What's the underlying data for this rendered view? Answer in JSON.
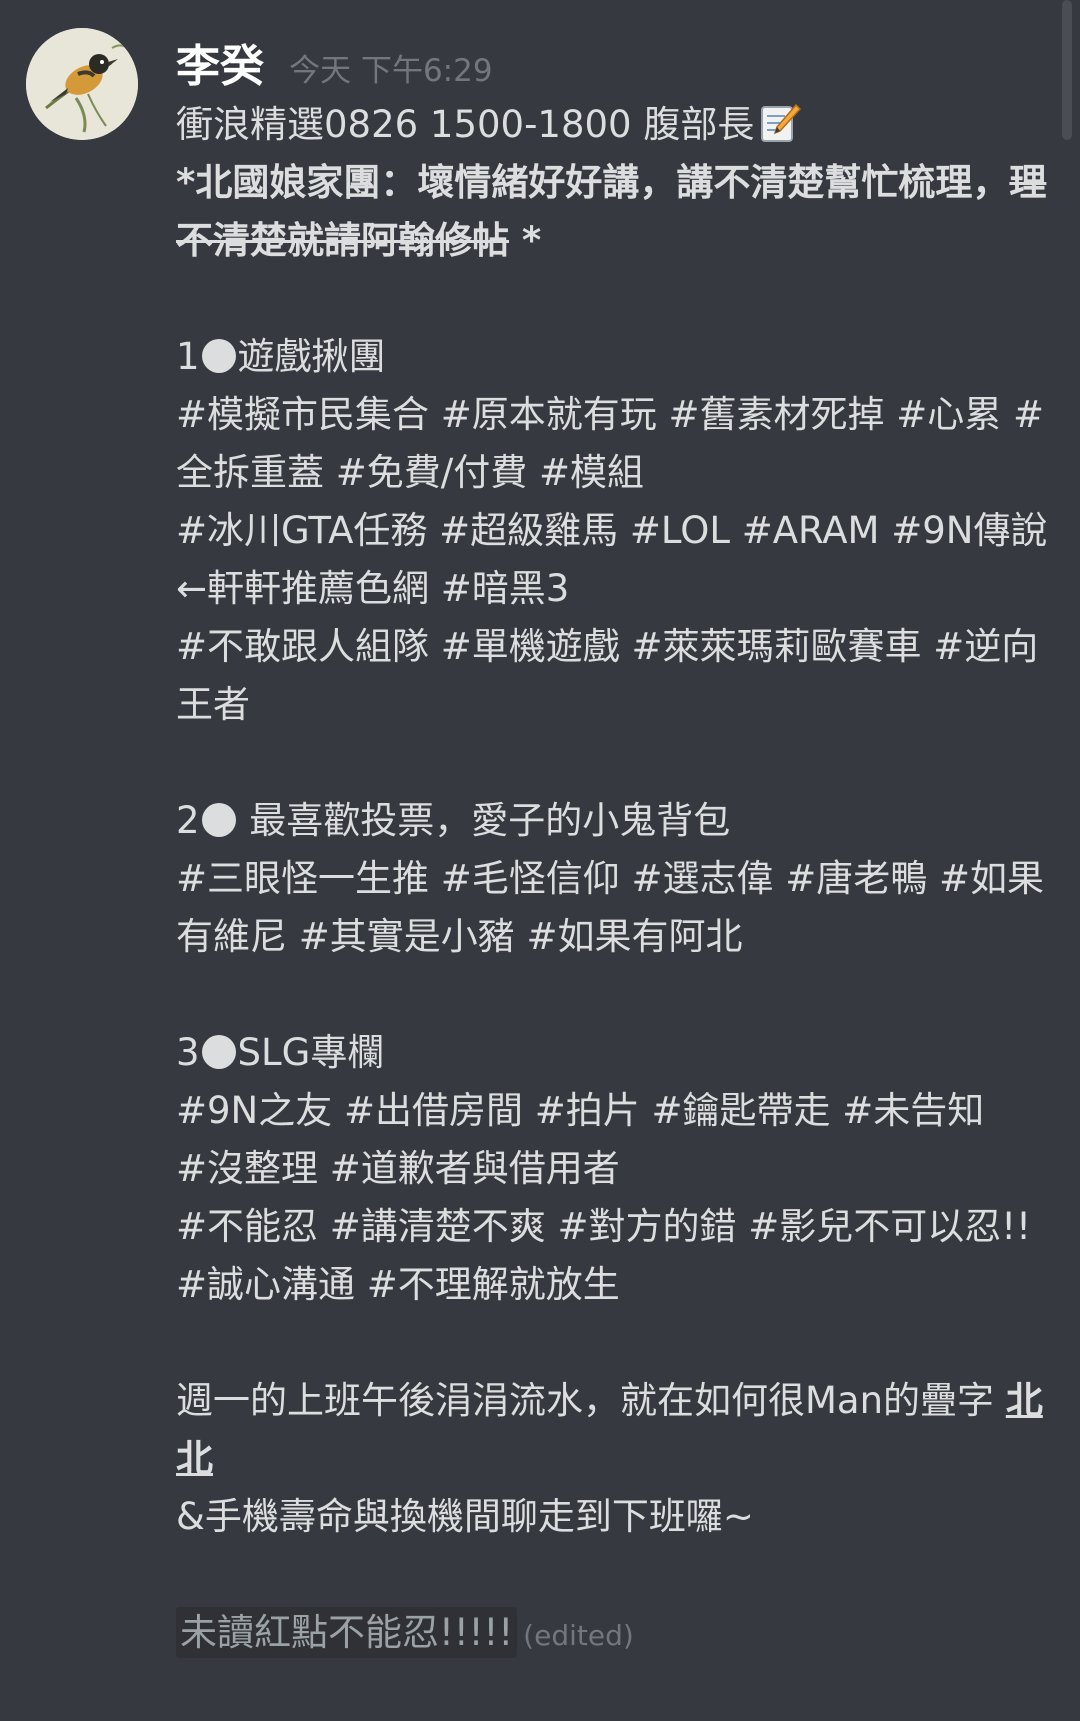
{
  "user": {
    "name": "李癸",
    "timestamp": "今天 下午6:29"
  },
  "message": {
    "title": "衝浪精選0826  1500-1800 腹部長",
    "subtitle_bold": "*北國娘家團：壞情緒好好講，講不清楚幫忙梳理，",
    "subtitle_strike": "理不清楚就請阿翰修帖",
    "subtitle_tail": " *",
    "sec1_num": "1",
    "sec1_title": "遊戲揪團",
    "sec1_tags": "#模擬市民集合 #原本就有玩 #舊素材死掉 #心累 #全拆重蓋 #免費/付費 #模組",
    "sec1_tags2": "#冰川GTA任務  #超級雞馬 #LOL #ARAM #9N傳說 ←軒軒推薦色網 #暗黑3",
    "sec1_tags3": "#不敢跟人組隊 #單機遊戲 #萊萊瑪莉歐賽車 #逆向王者",
    "sec2_num": "2",
    "sec2_title": " 最喜歡投票，愛子的小鬼背包",
    "sec2_tags": "#三眼怪一生推 #毛怪信仰 #選志偉 #唐老鴨 #如果有維尼 #其實是小豬 #如果有阿北",
    "sec3_num": "3",
    "sec3_title": "SLG專欄",
    "sec3_tags": "#9N之友 #出借房間 #拍片 #鑰匙帶走 #未告知",
    "sec3_tags2": "#沒整理 #道歉者與借用者",
    "sec3_tags3": "#不能忍 #講清楚不爽 #對方的錯 #影兒不可以忍!! #誠心溝通 #不理解就放生",
    "outro_pre": "週一的上班午後涓涓流水，就在如何很Man的疊字 ",
    "outro_link": "北北",
    "outro2": "&手機壽命與換機間聊走到下班囉~",
    "final": "未讀紅點不能忍!!!!!",
    "edited": "(edited)"
  },
  "colors": {
    "background": "#36393f",
    "text": "#dcddde",
    "muted": "#72767d",
    "username": "#ffffff"
  },
  "icons": {
    "avatar": "bird-avatar-icon",
    "memo": "memo-emoji-icon",
    "bullet": "black-circle-bullet-icon"
  }
}
